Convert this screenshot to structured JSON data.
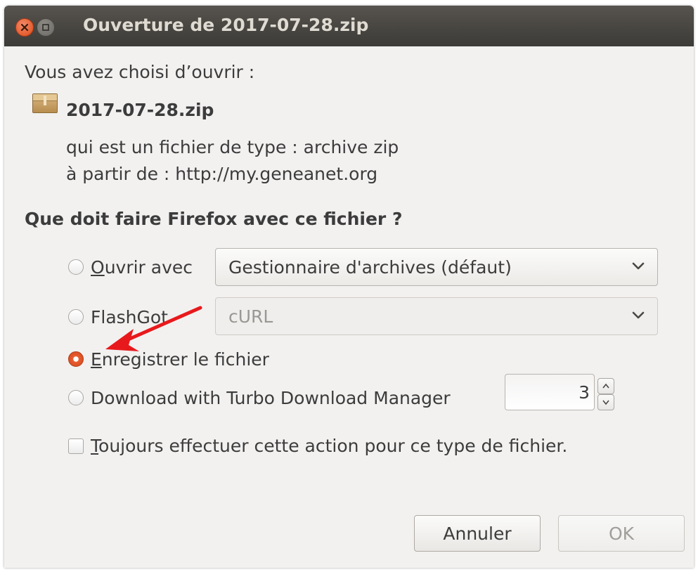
{
  "window": {
    "title": "Ouverture de 2017-07-28.zip"
  },
  "intro": "Vous avez choisi d’ouvrir :",
  "file": {
    "name": "2017-07-28.zip",
    "icon": "archive-icon",
    "type_line": "qui est un fichier de type : archive zip",
    "source_line": "à partir de : http://my.geneanet.org"
  },
  "question": "Que doit faire Firefox avec ce fichier ?",
  "options": {
    "open_with": {
      "label": "Ouvrir avec",
      "mnemonic": "O",
      "rest": "uvrir avec",
      "selected": false,
      "app": "Gestionnaire d'archives (défaut)"
    },
    "flashgot": {
      "label": "FlashGot",
      "selected": false,
      "app": "cURL"
    },
    "save": {
      "label": "Enregistrer le fichier",
      "mnemonic": "E",
      "rest": "nregistrer le fichier",
      "selected": true
    },
    "turbo": {
      "label": "Download with Turbo Download Manager",
      "selected": false,
      "threads": "3"
    }
  },
  "always": {
    "label": "Toujours effectuer cette action pour ce type de fichier.",
    "mnemonic": "T",
    "rest": "oujours effectuer cette action pour ce type de fichier.",
    "checked": false
  },
  "buttons": {
    "cancel": "Annuler",
    "ok": "OK"
  },
  "colors": {
    "accent": "#dd4814",
    "annotation_arrow": "#e8191c",
    "titlebar": "#3c3b37"
  }
}
